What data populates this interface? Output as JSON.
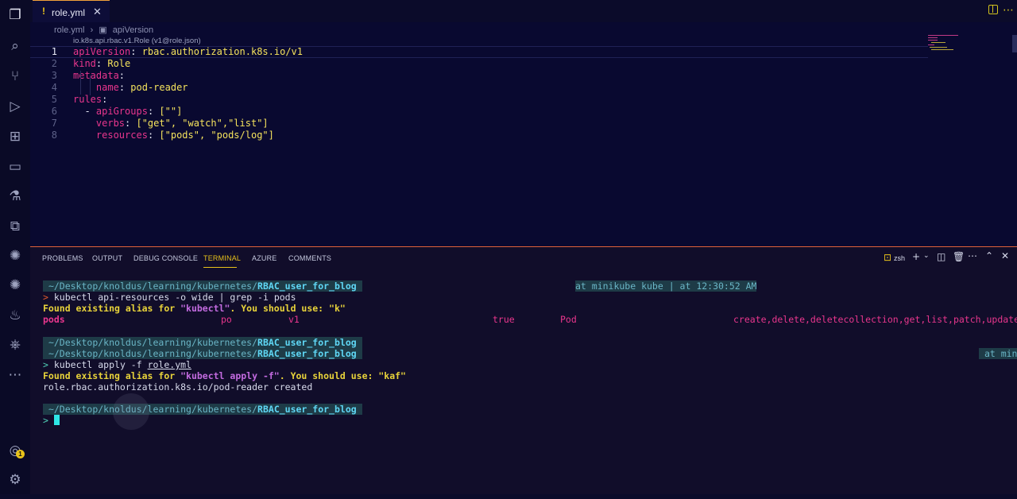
{
  "tab": {
    "filename": "role.yml",
    "warn": "!",
    "close": "✕"
  },
  "breadcrumb": {
    "file": "role.yml",
    "sep": "›",
    "symbol": "apiVersion"
  },
  "schema": "io.k8s.api.rbac.v1.Role (v1@role.json)",
  "code": [
    {
      "n": "1",
      "key": "apiVersion",
      "value": "rbac.authorization.k8s.io/v1"
    },
    {
      "n": "2",
      "key": "kind",
      "value": "Role"
    },
    {
      "n": "3",
      "key": "metadata"
    },
    {
      "n": "4",
      "key": "name",
      "value": "pod-reader"
    },
    {
      "n": "5",
      "key": "rules"
    },
    {
      "n": "6",
      "key": "apiGroups",
      "value": "[\"\"]"
    },
    {
      "n": "7",
      "key": "verbs",
      "value": "[\"get\", \"watch\",\"list\"]"
    },
    {
      "n": "8",
      "key": "resources",
      "value": "[\"pods\", \"pods/log\"]"
    }
  ],
  "panel": {
    "tabs": [
      "PROBLEMS",
      "OUTPUT",
      "DEBUG CONSOLE",
      "TERMINAL",
      "AZURE",
      "COMMENTS"
    ],
    "shell": "zsh"
  },
  "terminal": {
    "cwd_prefix": "~/Desktop/knoldus/learning/kubernetes/",
    "cwd_dir": "RBAC_user_for_blog",
    "context1": "at minikube kube | at 12:30:52 AM",
    "context2": "at mini",
    "prompt": ">",
    "cmd1": "kubectl api-resources -o wide | grep -i pods",
    "hint1_pre": "Found existing alias for ",
    "hint1_cmd": "\"kubectl\"",
    "hint1_mid": ". You should use: ",
    "hint1_alias": "\"k\"",
    "row": {
      "name": "pods",
      "short": "po",
      "version": "v1",
      "namespaced": "true",
      "kind": "Pod",
      "verbs": "create,delete,deletecollection,get,list,patch,update,wa"
    },
    "cmd2_pre": "kubectl apply -f ",
    "cmd2_file": "role.yml",
    "hint2_cmd": "\"kubectl apply -f\"",
    "hint2_alias": "\"kaf\"",
    "result": "role.rbac.authorization.k8s.io/pod-reader created"
  },
  "colors": {
    "accent": "#e8c21a",
    "key": "#e9368d",
    "string": "#f5e35d",
    "border": "#e0623a"
  }
}
